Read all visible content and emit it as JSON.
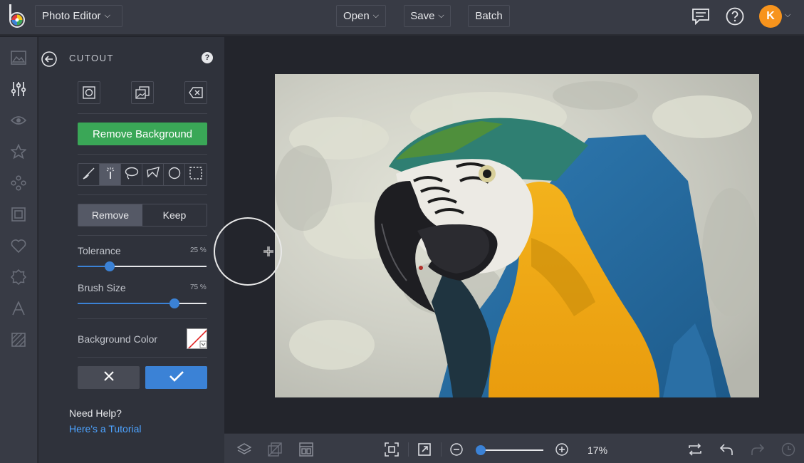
{
  "app": {
    "switcher_label": "Photo Editor"
  },
  "toolbar": {
    "open_label": "Open",
    "save_label": "Save",
    "batch_label": "Batch",
    "avatar_initial": "K"
  },
  "panel": {
    "title": "CUTOUT",
    "help_glyph": "?",
    "remove_background_label": "Remove Background",
    "mode_options": [
      "Remove",
      "Keep"
    ],
    "selected_mode": "Remove",
    "tolerance": {
      "label": "Tolerance",
      "value": 25,
      "value_text": "25 %"
    },
    "brush_size": {
      "label": "Brush Size",
      "value": 75,
      "value_text": "75 %"
    },
    "background_color_label": "Background Color",
    "need_help": "Need Help?",
    "tutorial_link": "Here's a Tutorial"
  },
  "bottom": {
    "zoom_value": 17,
    "zoom_text": "17%"
  },
  "colors": {
    "accent_blue": "#3b82d6",
    "green": "#3aa757",
    "avatar_orange": "#f7941d",
    "link": "#4da3ff"
  }
}
